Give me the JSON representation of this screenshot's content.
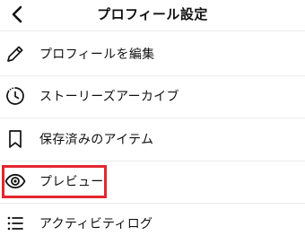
{
  "header": {
    "title": "プロフィール設定",
    "back_icon": "chevron-left-icon"
  },
  "menu": {
    "items": [
      {
        "label": "プロフィールを編集",
        "icon": "pencil-icon"
      },
      {
        "label": "ストーリーズアーカイブ",
        "icon": "clock-history-icon"
      },
      {
        "label": "保存済みのアイテム",
        "icon": "bookmark-icon"
      },
      {
        "label": "プレビュー",
        "icon": "eye-icon"
      },
      {
        "label": "アクティビティログ",
        "icon": "list-icon"
      }
    ]
  },
  "highlight": {
    "target": "プレビュー",
    "color": "#e3262e"
  }
}
